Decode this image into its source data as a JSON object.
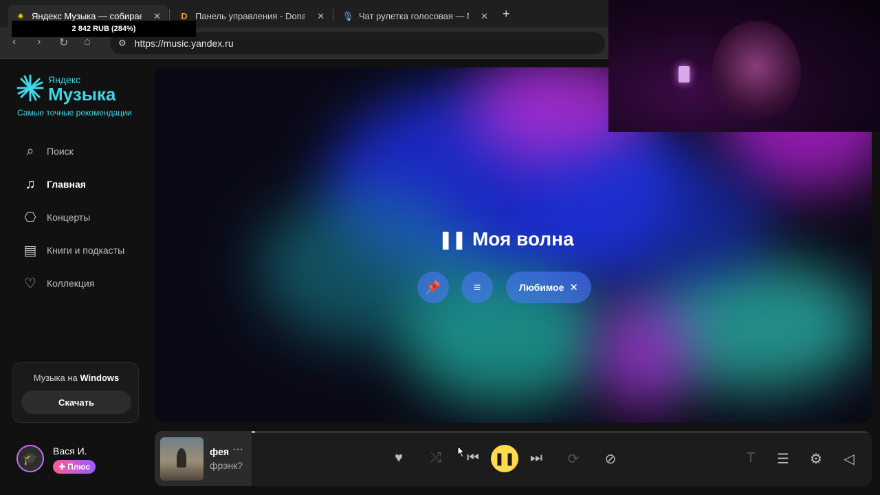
{
  "browser": {
    "tabs": [
      {
        "title": "Яндекс Музыка — собираем",
        "close": "✕"
      },
      {
        "title": "Панель управления - Donation",
        "close": "✕"
      },
      {
        "title": "Чат рулетка голосовая — Nek",
        "close": "✕"
      }
    ],
    "new_tab": "+",
    "overlay_text": "2 842 RUB (284%)",
    "url": "https://music.yandex.ru"
  },
  "sidebar": {
    "logo_small": "Яндекс",
    "logo_big": "Музыка",
    "tagline": "Самые точные рекомендации",
    "nav": [
      {
        "label": "Поиск",
        "icon": "search-icon",
        "active": false
      },
      {
        "label": "Главная",
        "icon": "music-note-icon",
        "active": true
      },
      {
        "label": "Концерты",
        "icon": "ticket-icon",
        "active": false
      },
      {
        "label": "Книги и подкасты",
        "icon": "book-icon",
        "active": false
      },
      {
        "label": "Коллекция",
        "icon": "heart-icon",
        "active": false
      }
    ],
    "promo": {
      "text_prefix": "Музыка на ",
      "text_bold": "Windows",
      "button": "Скачать"
    },
    "user": {
      "name": "Вася И.",
      "badge": "Плюс"
    }
  },
  "hero": {
    "title": "Моя волна",
    "chip_favorite": "Любимое",
    "chip_close": "✕"
  },
  "player": {
    "title": "фея",
    "more": "···",
    "artist": "фрэнк?",
    "progress": 0.14,
    "accent": "#ffdb4d"
  }
}
